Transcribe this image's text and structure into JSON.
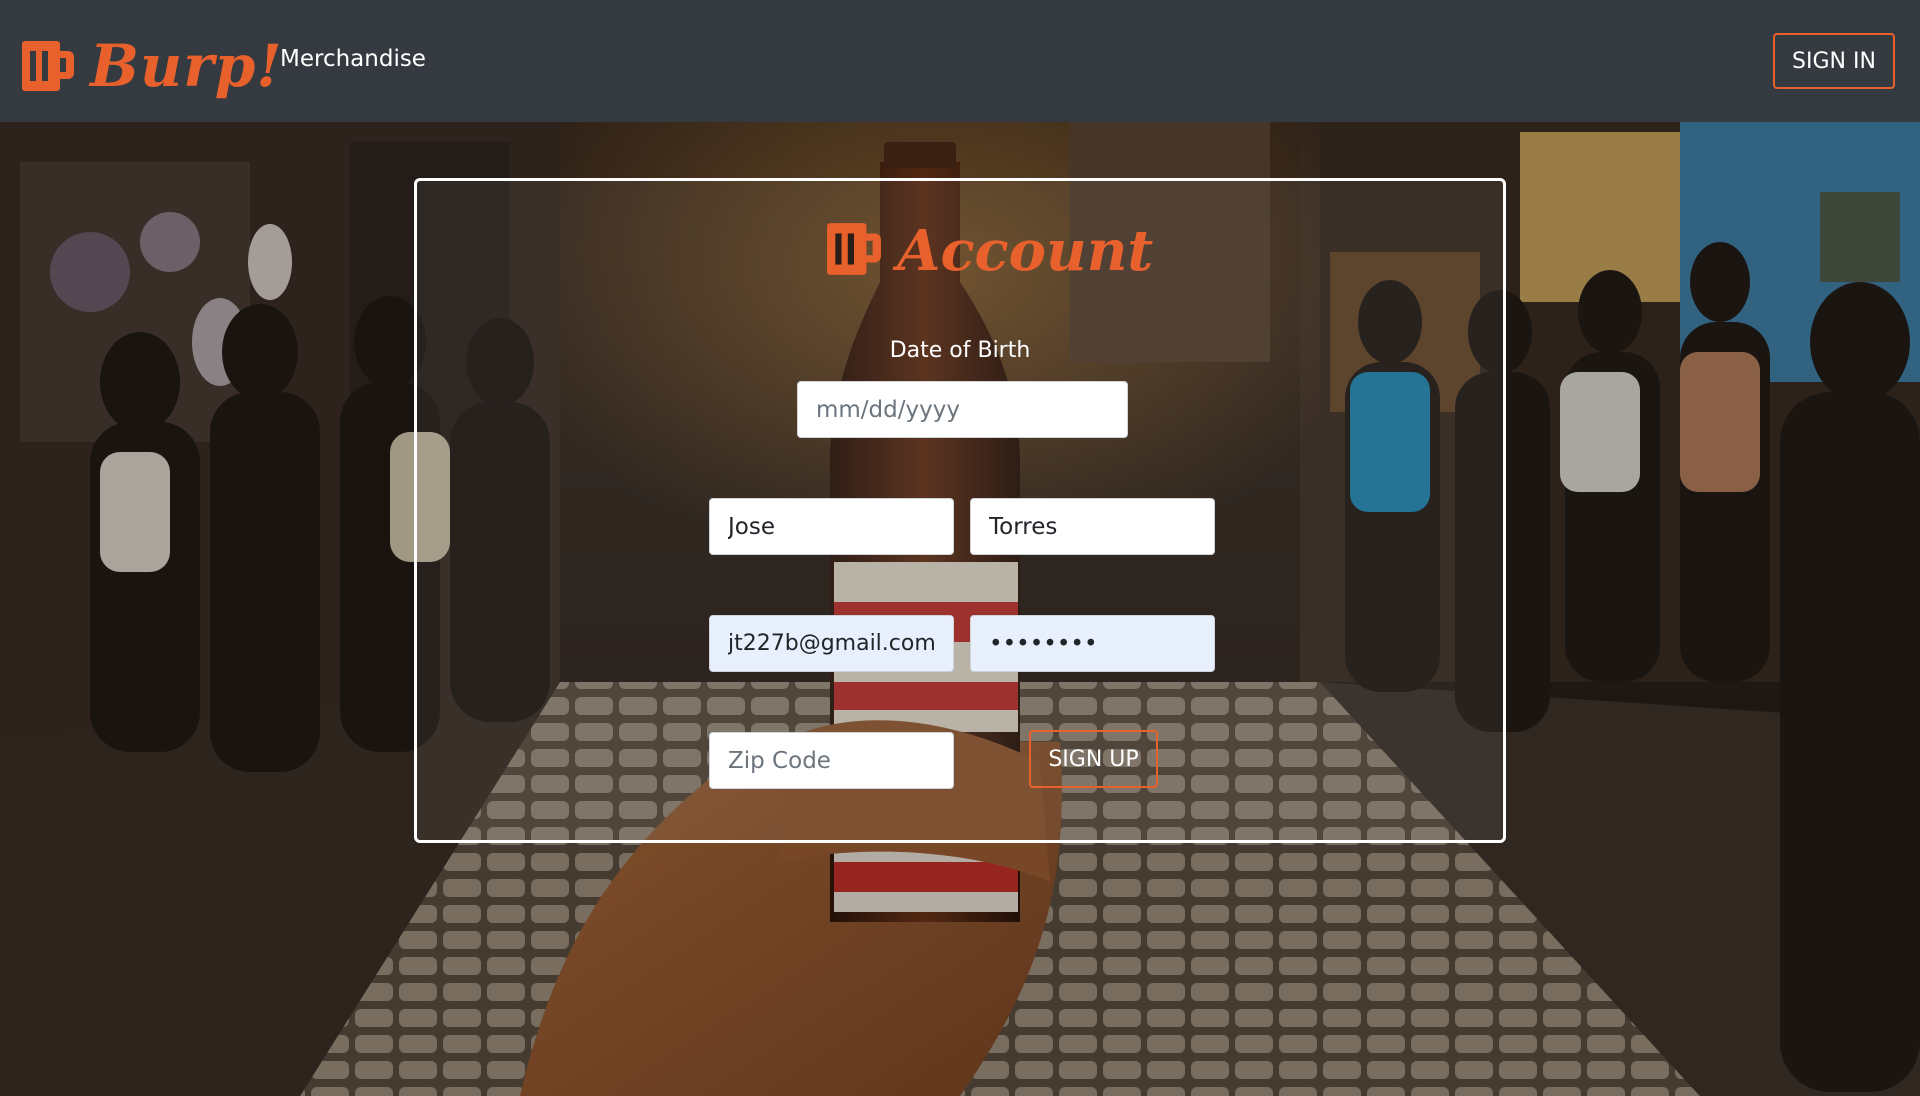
{
  "navbar": {
    "brand": {
      "text": "Burp!",
      "icon": "beer-mug-icon"
    },
    "links": [
      {
        "label": "Merchandise"
      }
    ],
    "sign_in_label": "SIGN IN"
  },
  "form": {
    "logo": {
      "text": "Account",
      "icon": "beer-mug-icon"
    },
    "dob_label": "Date of Birth",
    "dob_placeholder": "mm/dd/yyyy",
    "first_name_value": "Jose",
    "last_name_value": "Torres",
    "email_value": "jt227b@gmail.com",
    "password_value": "••••••••",
    "zip_placeholder": "Zip Code",
    "signup_label": "SIGN UP"
  },
  "colors": {
    "accent": "#e8612c",
    "navbar_bg": "#343a40",
    "autofill_bg": "#e8f0fe"
  }
}
